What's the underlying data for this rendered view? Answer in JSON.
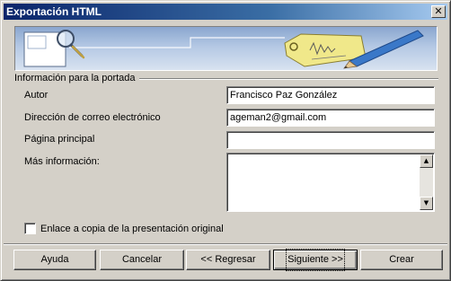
{
  "window": {
    "title": "Exportación HTML",
    "close_glyph": "✕"
  },
  "banner": {
    "icons": [
      "magnifier-icon",
      "price-tag-icon",
      "pencil-icon"
    ],
    "colors": {
      "sky": "#8aa6cf",
      "tag": "#e8e070",
      "pencil": "#3a78c8"
    }
  },
  "group": {
    "label": "Información para la portada"
  },
  "fields": {
    "author": {
      "label": "Autor",
      "value": "Francisco Paz González"
    },
    "email": {
      "label": "Dirección de correo electrónico",
      "value": "ageman2@gmail.com"
    },
    "homepage": {
      "label": "Página principal",
      "value": ""
    },
    "more_info": {
      "label": "Más información:",
      "value": ""
    }
  },
  "checkbox": {
    "label": "Enlace a copia de la presentación original",
    "checked": false
  },
  "buttons": {
    "help": "Ayuda",
    "cancel": "Cancelar",
    "back": "<< Regresar",
    "next": "Siguiente >>",
    "create": "Crear"
  }
}
